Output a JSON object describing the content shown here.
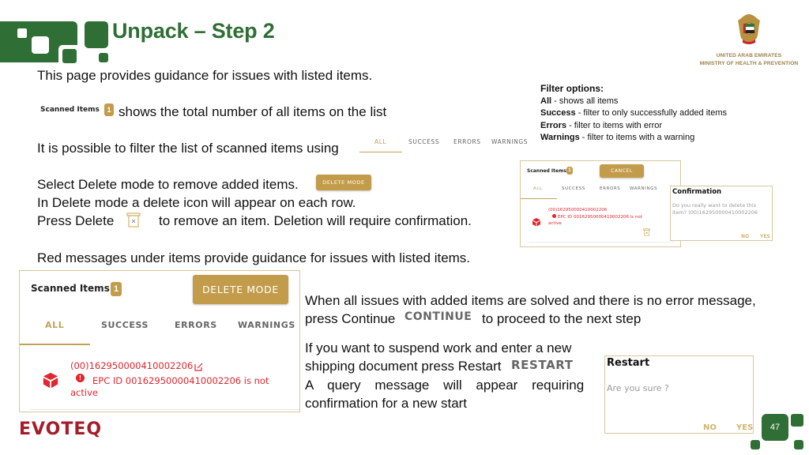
{
  "header": {
    "title": "Unpack – Step 2",
    "ministry": {
      "line1": "UNITED ARAB EMIRATES",
      "line2": "MINISTRY OF HEALTH & PREVENTION"
    }
  },
  "intro": {
    "guidance": "This page provides guidance for issues with listed items.",
    "scanned_label": "Scanned Items",
    "scanned_count": "1",
    "scanned_desc": "shows the total number of all items on the list",
    "filter_desc": "It is possible to filter the list of scanned items using",
    "delete_select": "Select Delete mode to remove added items.",
    "delete_row": "In Delete mode a delete icon will appear on each row.",
    "press_delete": "Press Delete",
    "press_delete_rest": "to remove an item. Deletion will require confirmation.",
    "red_messages": "Red messages under items provide guidance for issues with listed items."
  },
  "tabs": [
    "ALL",
    "SUCCESS",
    "ERRORS",
    "WARNINGS"
  ],
  "buttons": {
    "delete_mode": "DELETE MODE",
    "cancel": "CANCEL",
    "continue": "CONTINUE",
    "restart": "RESTART",
    "no": "NO",
    "yes": "YES"
  },
  "filter_options": {
    "heading": "Filter options:",
    "items": [
      {
        "name": "All",
        "desc": " - shows all items"
      },
      {
        "name": "Success",
        "desc": " - filter to only successfully added items"
      },
      {
        "name": "Errors",
        "desc": " - filter to items with error"
      },
      {
        "name": "Warnings",
        "desc": " - filter to items with a warning"
      }
    ]
  },
  "item": {
    "code": "(00)162950000410002206",
    "error": "EPC ID 00162950000410002206 is not active"
  },
  "confirmation": {
    "title": "Confirmation",
    "message": "Do you really want to delete this item? (00)162950000410002206"
  },
  "continue_text": {
    "line1": "When all issues with added items are solved and there is no error message,",
    "line2_pre": "press Continue",
    "line2_post": "to proceed to the next step"
  },
  "restart_text": {
    "line1": "If you want to suspend work and enter a new",
    "line2_pre": "shipping document press Restart",
    "line3": "A query message will appear requiring",
    "line4": "confirmation for a new start"
  },
  "restart_dialog": {
    "title": "Restart",
    "message": "Are you sure ?"
  },
  "footer": {
    "brand": "EVOTEQ",
    "page_number": "47"
  },
  "colors": {
    "brand_green": "#2f6e35",
    "gold": "#c29c4b",
    "error_red": "#e0262e",
    "evoteq_red": "#a51c2a"
  }
}
